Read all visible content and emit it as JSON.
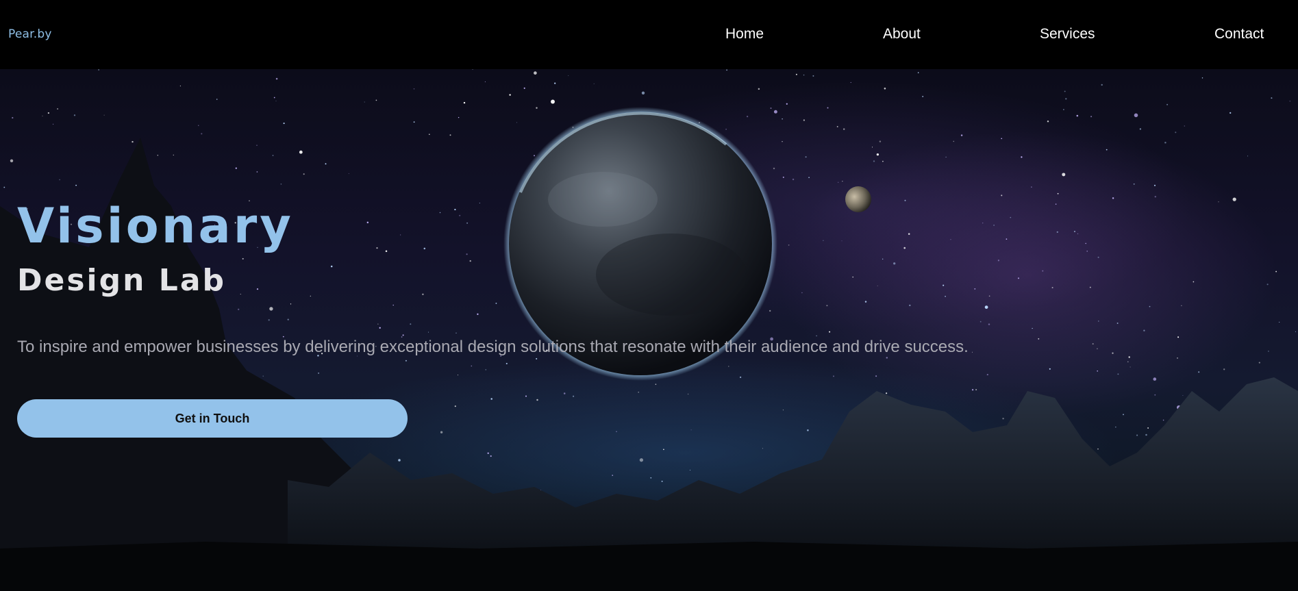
{
  "brand": {
    "logo_text": "Pear.by",
    "accent_color": "#93c2ea"
  },
  "nav": {
    "items": [
      {
        "label": "Home"
      },
      {
        "label": "About"
      },
      {
        "label": "Services"
      },
      {
        "label": "Contact"
      }
    ]
  },
  "hero": {
    "title": "Visionary",
    "subtitle": "Design Lab",
    "description": "To inspire and empower businesses by delivering exceptional design solutions that resonate with their audience and drive success.",
    "cta_label": "Get in Touch",
    "background": "space-planet-moon-mountains-image"
  }
}
